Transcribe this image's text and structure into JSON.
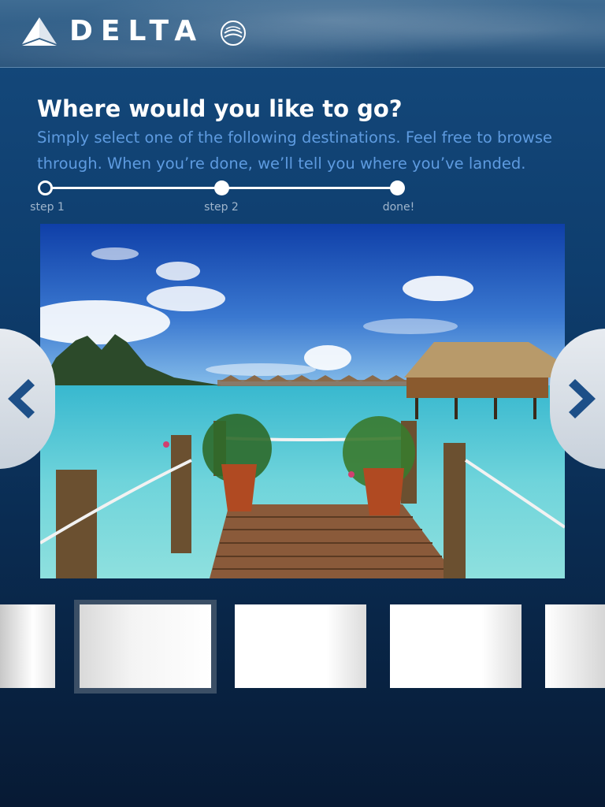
{
  "header": {
    "brand": "DELTA",
    "partner_logo_icon": "skyteam-logo",
    "brand_icon": "delta-widget-logo"
  },
  "main": {
    "title": "Where would you like to go?",
    "subtitle": "Simply select one of the following destinations. Feel free to browse through. When you’re done, we’ll tell you where you’ve landed."
  },
  "progress": {
    "current_step": 1,
    "steps": [
      {
        "label": "step 1"
      },
      {
        "label": "step 2"
      },
      {
        "label": "done!"
      }
    ]
  },
  "photo": {
    "subject": "overwater bungalows and wooden dock over turquoise lagoon"
  },
  "navigation": {
    "prev_icon": "chevron-left-icon",
    "next_icon": "chevron-right-icon"
  },
  "thumbnails": {
    "selected_index": 1,
    "count": 5
  },
  "colors": {
    "accent_text": "#5e9be0",
    "background_top": "#154a7d",
    "background_bottom": "#071a34",
    "chevron": "#1d4f88"
  }
}
